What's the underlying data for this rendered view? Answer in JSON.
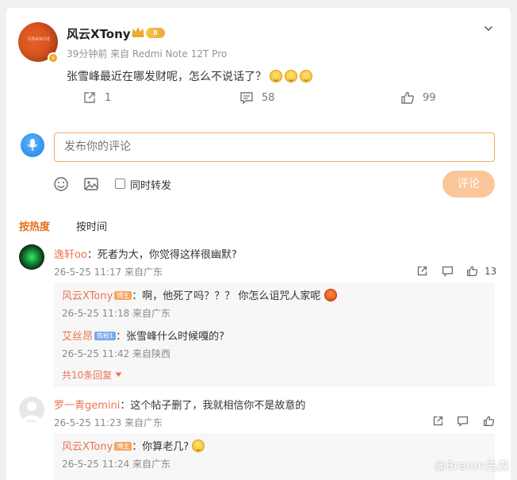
{
  "post": {
    "author": "风云XTony",
    "level_badge": "Ⅱ",
    "time_meta": "39分钟前  来自 Redmi Note 12T Pro",
    "text": "张雪峰最近在哪发财呢，怎么不说话了？",
    "avatar_caption": "ORANGE",
    "repost_count": "1",
    "comment_count": "58",
    "like_count": "99"
  },
  "composer": {
    "placeholder": "发布你的评论",
    "forward_label": "同时转发",
    "submit_label": "评论"
  },
  "sort": {
    "hot": "按热度",
    "time": "按时间"
  },
  "comments": [
    {
      "name": "逸轩oo",
      "text": "：死者为大，你觉得这样很幽默?",
      "meta": "26-5-25 11:17 来自广东",
      "likes": "13",
      "replies": [
        {
          "name": "风云XTony",
          "badge": "博主",
          "text": "：啊，他死了吗？？？ 你怎么诅咒人家呢",
          "meta": "26-5-25 11:18 来自广东"
        },
        {
          "name": "艾丝昂",
          "badge": "铁粉1",
          "text": "：张雪峰什么时候嘎的?",
          "meta": "26-5-25 11:42 来自陕西"
        }
      ],
      "more_replies": "共10条回复"
    },
    {
      "name": "罗一青gemini",
      "text": "：这个帖子删了，我就相信你不是故意的",
      "meta": "26-5-25 11:23 来自广东",
      "replies": [
        {
          "name": "风云XTony",
          "badge": "博主",
          "text": "：你算老几?",
          "meta": "26-5-25 11:24 来自广东"
        }
      ]
    }
  ],
  "watermark": "@Braum先森"
}
